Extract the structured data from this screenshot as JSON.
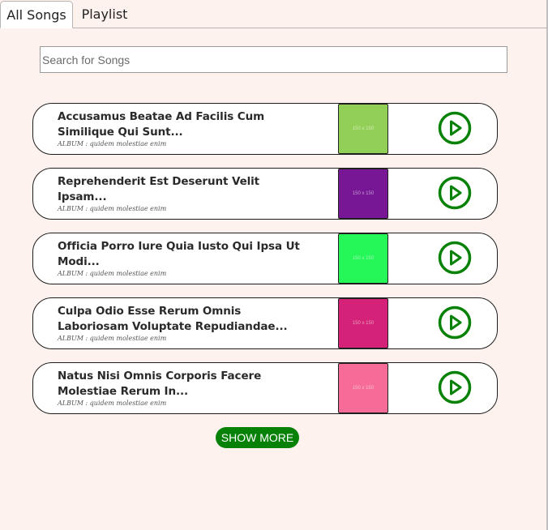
{
  "tabs": [
    {
      "label": "All Songs",
      "active": true
    },
    {
      "label": "Playlist",
      "active": false
    }
  ],
  "search": {
    "placeholder": "Search for Songs",
    "value": ""
  },
  "songs": [
    {
      "title": "Accusamus Beatae Ad Facilis Cum Similique Qui Sunt...",
      "album": "ALBUM : quidem molestiae enim",
      "thumb_color": "#92cf56",
      "thumb_label": "150 x 150",
      "action_icon": "play-circle-icon"
    },
    {
      "title": "Reprehenderit Est Deserunt Velit Ipsam...",
      "album": "ALBUM : quidem molestiae enim",
      "thumb_color": "#771796",
      "thumb_label": "150 x 150",
      "action_icon": "play-circle-icon"
    },
    {
      "title": "Officia Porro Iure Quia Iusto Qui Ipsa Ut Modi...",
      "album": "ALBUM : quidem molestiae enim",
      "thumb_color": "#24f757",
      "thumb_label": "150 x 150",
      "action_icon": "play-circle-icon"
    },
    {
      "title": "Culpa Odio Esse Rerum Omnis Laboriosam Voluptate Repudiandae...",
      "album": "ALBUM : quidem molestiae enim",
      "thumb_color": "#d32277",
      "thumb_label": "150 x 150",
      "action_icon": "play-circle-icon"
    },
    {
      "title": "Natus Nisi Omnis Corporis Facere Molestiae Rerum In...",
      "album": "ALBUM : quidem molestiae enim",
      "thumb_color": "#f66b97",
      "thumb_label": "150 x 150",
      "action_icon": "play-circle-icon"
    }
  ],
  "show_more_label": "SHOW MORE",
  "colors": {
    "accent": "#078107",
    "page_background": "#fdf2ee"
  }
}
